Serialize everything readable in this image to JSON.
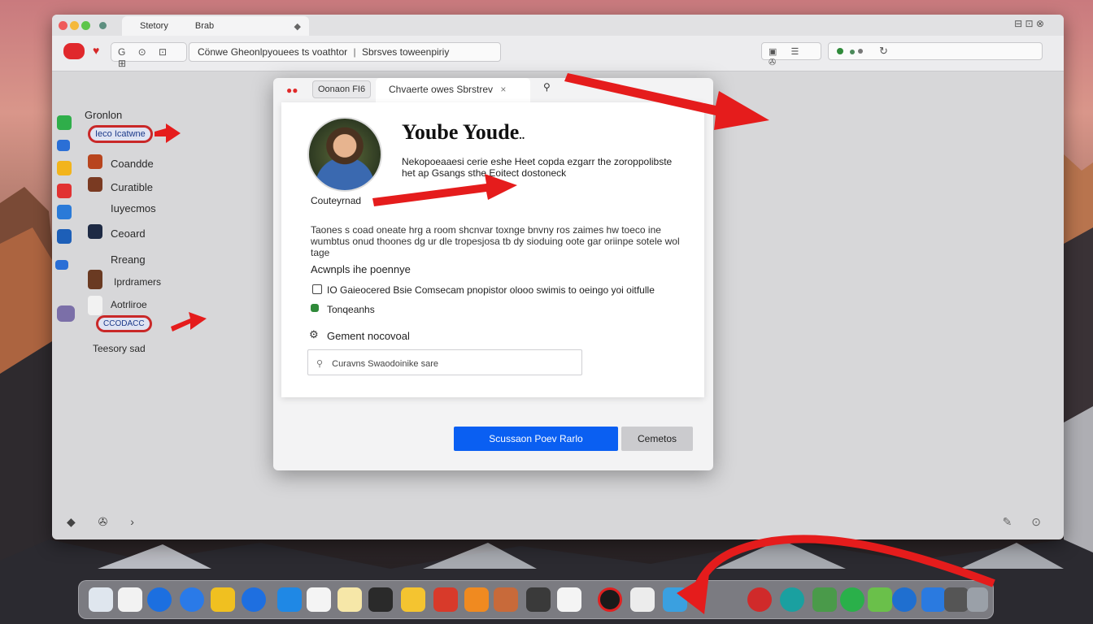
{
  "colors": {
    "accent_blue": "#0a5ff2",
    "annotation_red": "#e51c1c",
    "record_red": "#e0282c"
  },
  "titlebar": {
    "tab_title": "Stetory",
    "tab_subtitle": "Brab",
    "tab_close": "◆",
    "window_controls": "⊟ ⊡ ⊗"
  },
  "toolbar": {
    "nav_group": "G ⊙ ⊡ ⊞",
    "url_left": "Cönwe",
    "url_main": "Gheonlpyouees ts voathtor",
    "url_separator": "|",
    "url_right": "Sbrsves toweenpiriy",
    "right_group": "▣ ☰ ✇",
    "reload_icon": "↻"
  },
  "sidebar": {
    "heading": "Gronlon",
    "highlighted_pill": "Ieco Icatwne",
    "items": [
      {
        "label": "Coandde"
      },
      {
        "label": "Curatible"
      },
      {
        "label": "Iuyecmos"
      },
      {
        "label": "Ceoard"
      },
      {
        "label": "Rreang"
      },
      {
        "label": "Iprdramers"
      },
      {
        "label": "Aotrliroe"
      }
    ],
    "lower_pill": "CCODACC",
    "footer_item": "Teesory sad",
    "bottom_left_icons": "◆ ✇ ›",
    "bottom_right_icons": "✎ ⊙"
  },
  "dialog": {
    "tab1": "Oonaon FI6",
    "tab2": "Chvaerte owes Sbrstrev",
    "tab2_close": "×",
    "title": "Yoube Youde",
    "title_suffix": "..",
    "description": "Nekopoeaaesi cerie eshe Heet copda ezgarr the zoroppolibste het ap Gsangs sthe Eoitect dostoneck",
    "section1_label": "Couteyrnad",
    "paragraph": "Taones s coad oneate hrg a room shcnvar toxnge bnvny ros zaimes hw toeco ine wumbtus onud thoones dg ur dle tropesjosa tb dy sioduing oote gar oriinpe sotele wol tage",
    "section2_label": "Acwnpls ihe poennye",
    "option1": "IO Gaieocered Bsie Comsecam pnopistor olooo swimis to oeingo yoi oitfulle",
    "option2": "Tonqeanhs",
    "section3_label": "Gement nocovoal",
    "search_placeholder": "Curavns Swaodoinike sare",
    "primary_button": "Scussaon Poev Rarlo",
    "secondary_button": "Cemetos"
  },
  "dock": {
    "items": [
      {
        "icon": "finder-icon"
      },
      {
        "icon": "document-icon"
      },
      {
        "icon": "safari-icon"
      },
      {
        "icon": "globe-icon"
      },
      {
        "icon": "notes-icon"
      },
      {
        "icon": "browser-icon"
      },
      {
        "icon": "photos-icon"
      },
      {
        "icon": "textedit-icon"
      },
      {
        "icon": "folder-icon"
      },
      {
        "icon": "files-icon"
      },
      {
        "icon": "keynote-icon"
      },
      {
        "icon": "puzzle-icon"
      },
      {
        "icon": "calendar-icon"
      },
      {
        "icon": "games-icon"
      },
      {
        "icon": "monitor-icon"
      },
      {
        "icon": "contacts-icon"
      },
      {
        "icon": "opera-icon"
      },
      {
        "icon": "book-icon"
      },
      {
        "icon": "preview-icon"
      },
      {
        "icon": "clock-icon"
      },
      {
        "icon": "chrome-icon"
      },
      {
        "icon": "terminal-icon"
      },
      {
        "icon": "messages-icon"
      },
      {
        "icon": "maps-icon"
      },
      {
        "icon": "appstore-icon"
      },
      {
        "icon": "mail-icon"
      },
      {
        "icon": "printer-icon"
      },
      {
        "icon": "trash-icon"
      }
    ]
  }
}
